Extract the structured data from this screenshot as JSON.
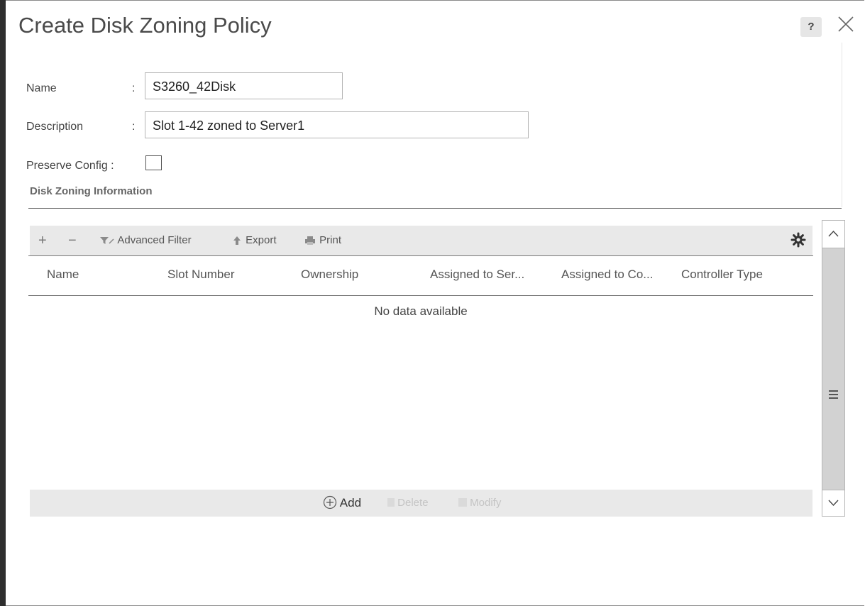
{
  "dialog": {
    "title": "Create Disk Zoning Policy",
    "help_label": "?"
  },
  "form": {
    "name_label": "Name",
    "name_value": "S3260_42Disk",
    "description_label": "Description",
    "description_value": "Slot 1-42 zoned to Server1",
    "preserve_label": "Preserve Config :",
    "colon": ":",
    "preserve_checked": false
  },
  "section": {
    "title": "Disk Zoning Information"
  },
  "toolbar": {
    "add_symbol": "+",
    "remove_symbol": "−",
    "filter_label": "Advanced Filter",
    "export_label": "Export",
    "print_label": "Print"
  },
  "table": {
    "columns": [
      "Name",
      "Slot Number",
      "Ownership",
      "Assigned to Ser...",
      "Assigned to Co...",
      "Controller Type"
    ],
    "empty_text": "No data available",
    "rows": []
  },
  "footer": {
    "add_label": "Add",
    "delete_label": "Delete",
    "modify_label": "Modify"
  },
  "colors": {
    "toolbar_bg": "#e9e9e9",
    "scroll_track": "#d2d2d2",
    "disabled_text": "#c4c4c4"
  }
}
